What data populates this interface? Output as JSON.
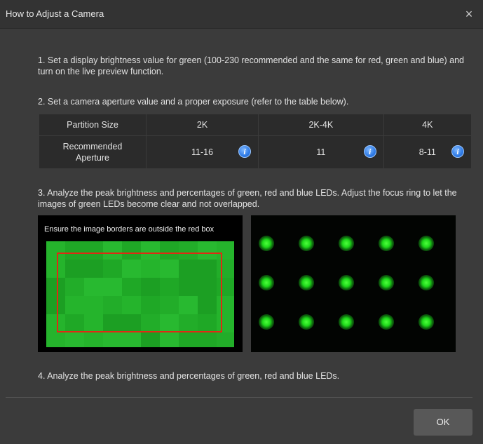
{
  "window": {
    "title": "How to Adjust a Camera",
    "close_glyph": "×"
  },
  "steps": {
    "step1": "1. Set a display brightness value for green (100-230 recommended and the same for red, green and blue) and turn on the live preview function.",
    "step2": "2. Set a camera aperture value and a proper exposure (refer to the table below).",
    "step3": "3. Analyze the peak brightness and percentages of green, red and blue LEDs. Adjust the focus ring to let the images of green LEDs become clear and not overlapped.",
    "step4": "4. Analyze the peak brightness and percentages of green, red and blue LEDs."
  },
  "aperture_table": {
    "header": [
      "Partition Size",
      "2K",
      "2K-4K",
      "4K"
    ],
    "row_label": "Recommended Aperture",
    "values": [
      "11-16",
      "11",
      "8-11"
    ],
    "info_icon": "info-icon",
    "info_glyph": "i"
  },
  "images": {
    "left_caption": "Ensure the image borders are outside the red box",
    "left_border_color": "#e02a14",
    "led_color": "#1ed81a"
  },
  "buttons": {
    "ok_label": "OK"
  },
  "colors": {
    "background": "#3b3b3b",
    "table_cell": "#2b2b2b",
    "info_blue": "#2f7be6"
  }
}
